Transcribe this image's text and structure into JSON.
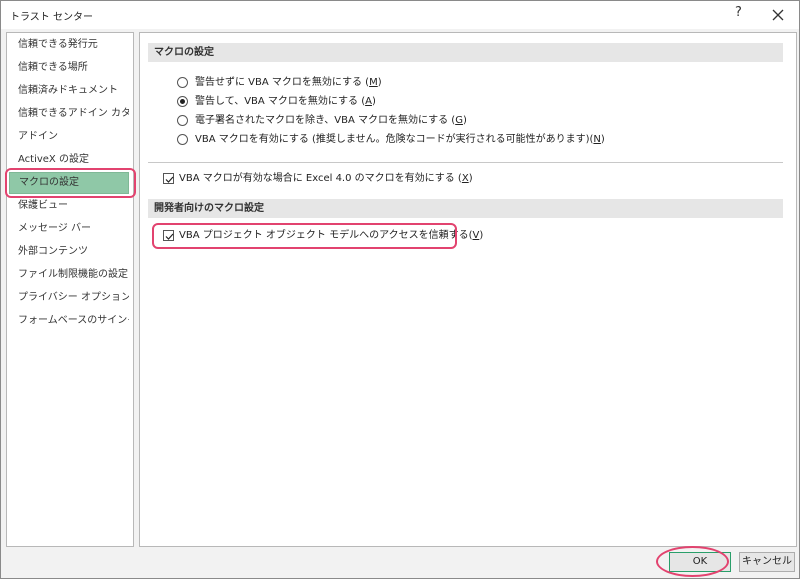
{
  "window": {
    "title": "トラスト センター",
    "help_label": "?",
    "close_icon": "close-icon"
  },
  "sidebar": {
    "items": [
      {
        "label": "信頼できる発行元"
      },
      {
        "label": "信頼できる場所"
      },
      {
        "label": "信頼済みドキュメント"
      },
      {
        "label": "信頼できるアドイン カタログ"
      },
      {
        "label": "アドイン"
      },
      {
        "label": "ActiveX の設定"
      },
      {
        "label": "マクロの設定",
        "selected": true
      },
      {
        "label": "保護ビュー"
      },
      {
        "label": "メッセージ バー"
      },
      {
        "label": "外部コンテンツ"
      },
      {
        "label": "ファイル制限機能の設定"
      },
      {
        "label": "プライバシー オプション"
      },
      {
        "label": "フォームベースのサインイン"
      }
    ]
  },
  "macro_settings": {
    "header": "マクロの設定",
    "options": [
      {
        "text": "警告せずに VBA マクロを無効にする (",
        "key": "M",
        "end": ")",
        "checked": false
      },
      {
        "text": "警告して、VBA マクロを無効にする (",
        "key": "A",
        "end": ")",
        "checked": true
      },
      {
        "text": "電子署名されたマクロを除き、VBA マクロを無効にする (",
        "key": "G",
        "end": ")",
        "checked": false
      },
      {
        "text": "VBA マクロを有効にする (推奨しません。危険なコードが実行される可能性があります)(",
        "key": "N",
        "end": ")",
        "checked": false
      }
    ],
    "excel4_checkbox": {
      "text": "VBA マクロが有効な場合に Excel 4.0 のマクロを有効にする (",
      "key": "X",
      "end": ")",
      "checked": true
    }
  },
  "developer_settings": {
    "header": "開発者向けのマクロ設定",
    "vba_access_checkbox": {
      "text": "VBA プロジェクト オブジェクト モデルへのアクセスを信頼する(",
      "key": "V",
      "end": ")",
      "checked": true
    }
  },
  "footer": {
    "ok_label": "OK",
    "cancel_label": "キャンセル"
  },
  "colors": {
    "selected_item_bg": "#8fc8a7",
    "annotation": "#e2436f",
    "ok_border": "#2a9f6a"
  }
}
